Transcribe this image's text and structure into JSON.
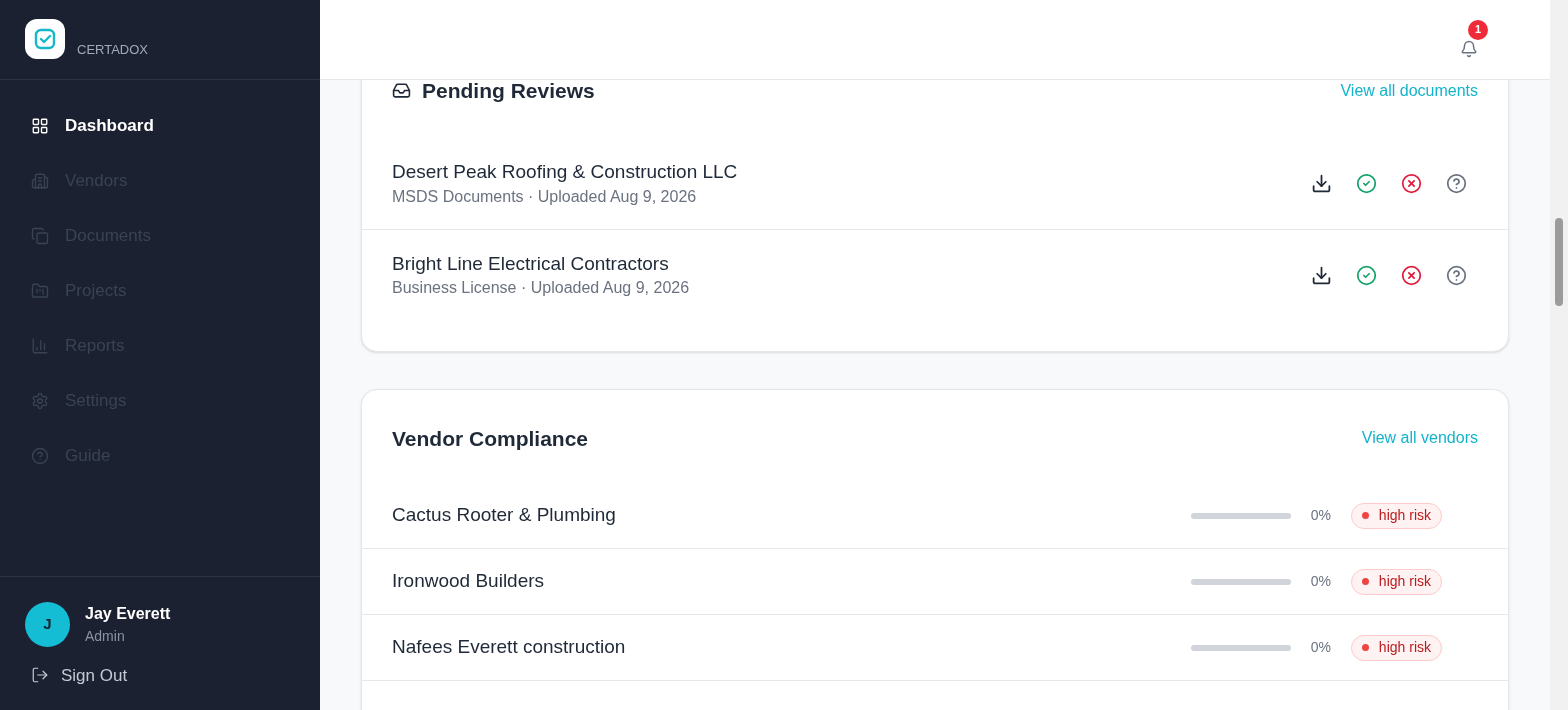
{
  "brand": {
    "name": "CERTADOX"
  },
  "nav": [
    {
      "label": "Dashboard",
      "selected": true
    },
    {
      "label": "Vendors",
      "selected": false
    },
    {
      "label": "Documents",
      "selected": false
    },
    {
      "label": "Projects",
      "selected": false
    },
    {
      "label": "Reports",
      "selected": false
    },
    {
      "label": "Settings",
      "selected": false
    },
    {
      "label": "Guide",
      "selected": false
    }
  ],
  "user": {
    "initial": "J",
    "name": "Jay Everett",
    "role": "Admin"
  },
  "sign_out": "Sign Out",
  "notifications": {
    "count": "1"
  },
  "pending_reviews": {
    "title": "Pending Reviews",
    "link": "View all documents",
    "items": [
      {
        "vendor": "Desert Peak Roofing & Construction LLC",
        "details": "MSDS Documents · Uploaded Aug 9, 2026"
      },
      {
        "vendor": "Bright Line Electrical Contractors",
        "details": "Business License · Uploaded Aug 9, 2026"
      }
    ]
  },
  "vendor_compliance": {
    "title": "Vendor Compliance",
    "link": "View all vendors",
    "items": [
      {
        "name": "Cactus Rooter & Plumbing",
        "percent": "0%",
        "risk": "high risk",
        "color": "#ef4444"
      },
      {
        "name": "Ironwood Builders",
        "percent": "0%",
        "risk": "high risk",
        "color": "#ef4444"
      },
      {
        "name": "Nafees Everett construction",
        "percent": "0%",
        "risk": "high risk",
        "color": "#ef4444"
      }
    ]
  }
}
